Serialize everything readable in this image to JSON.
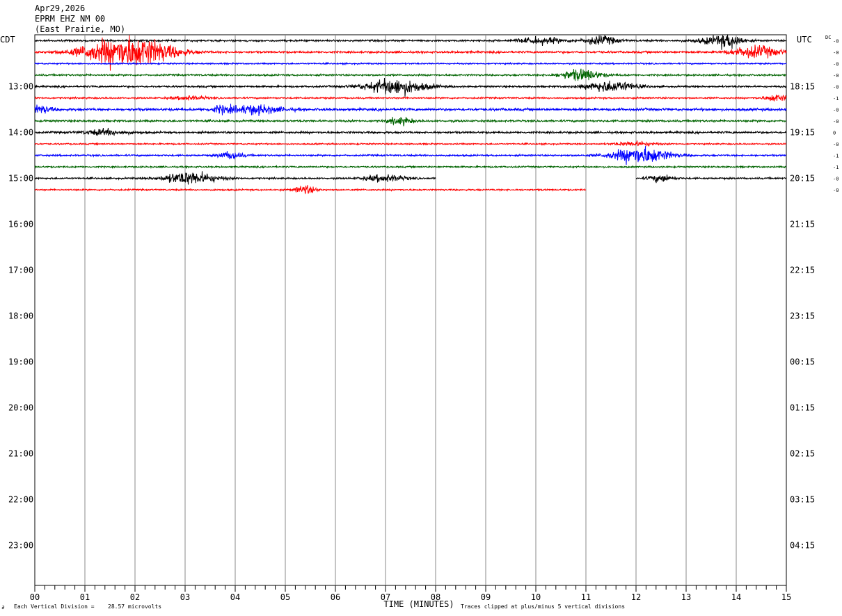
{
  "header": {
    "date": "Apr29,2026",
    "station": "EPRM EHZ NM 00",
    "location": "(East Prairie, MO)"
  },
  "left_timezone": "CDT",
  "right_timezone": "UTC",
  "dc_label": "DC",
  "footer": {
    "division_label": "Each Vertical Division =",
    "division_value": "28.57 microvolts",
    "clip_note": "Traces clipped at plus/minus 5 vertical divisions",
    "corner_mark": "∂"
  },
  "colors": [
    "#000000",
    "#ff0000",
    "#0000ff",
    "#006400"
  ],
  "chart_data": {
    "type": "line",
    "title": "EPRM EHZ NM 00",
    "xlabel": "TIME (MINUTES)",
    "xlim": [
      0,
      15
    ],
    "x_tick_labels": [
      "00",
      "01",
      "02",
      "03",
      "04",
      "05",
      "06",
      "07",
      "08",
      "09",
      "10",
      "11",
      "12",
      "13",
      "14",
      "15"
    ],
    "left_hour_labels": [
      "13:00",
      "14:00",
      "15:00",
      "16:00",
      "17:00",
      "18:00",
      "19:00",
      "20:00",
      "21:00",
      "22:00",
      "23:00"
    ],
    "right_hour_labels": [
      "18:15",
      "19:15",
      "20:15",
      "21:15",
      "22:15",
      "23:15",
      "00:15",
      "01:15",
      "02:15",
      "03:15",
      "04:15"
    ],
    "dc_offsets": [
      "-0",
      "-0",
      "-0",
      "-0",
      "-0",
      "-1",
      "-0",
      "-0",
      "0",
      "-0",
      "-1",
      "-1",
      "-0",
      "-0"
    ],
    "traces": [
      {
        "row": 0,
        "color": "black",
        "start_min": 0,
        "end_min": 15,
        "noise": 1.3,
        "events": [
          [
            10.1,
            1.2,
            4
          ],
          [
            11.3,
            0.8,
            6
          ],
          [
            13.6,
            1.0,
            5
          ],
          [
            13.9,
            0.6,
            7
          ]
        ]
      },
      {
        "row": 1,
        "color": "red",
        "start_min": 0,
        "end_min": 15,
        "noise": 1.4,
        "events": [
          [
            1.7,
            2.0,
            18
          ],
          [
            2.3,
            1.6,
            8
          ],
          [
            14.4,
            1.2,
            8
          ]
        ]
      },
      {
        "row": 2,
        "color": "blue",
        "start_min": 0,
        "end_min": 15,
        "noise": 1.0,
        "events": []
      },
      {
        "row": 3,
        "color": "green",
        "start_min": 0,
        "end_min": 15,
        "noise": 1.2,
        "events": [
          [
            10.9,
            1.0,
            8
          ]
        ]
      },
      {
        "row": 4,
        "color": "black",
        "start_min": 0,
        "end_min": 15,
        "noise": 1.3,
        "events": [
          [
            7.2,
            1.5,
            11
          ],
          [
            11.5,
            1.2,
            8
          ]
        ]
      },
      {
        "row": 5,
        "color": "red",
        "start_min": 0,
        "end_min": 15,
        "noise": 1.1,
        "events": [
          [
            3.1,
            0.8,
            3
          ],
          [
            14.8,
            0.6,
            5
          ]
        ]
      },
      {
        "row": 6,
        "color": "blue",
        "start_min": 0,
        "end_min": 15,
        "noise": 1.8,
        "events": [
          [
            0.1,
            0.6,
            5
          ],
          [
            3.7,
            0.5,
            4
          ],
          [
            4.4,
            1.3,
            6
          ]
        ]
      },
      {
        "row": 7,
        "color": "green",
        "start_min": 0,
        "end_min": 15,
        "noise": 1.4,
        "events": [
          [
            7.3,
            0.6,
            5
          ]
        ]
      },
      {
        "row": 8,
        "color": "black",
        "start_min": 0,
        "end_min": 15,
        "noise": 1.5,
        "events": [
          [
            1.4,
            1.0,
            4
          ]
        ]
      },
      {
        "row": 9,
        "color": "red",
        "start_min": 0,
        "end_min": 15,
        "noise": 1.0,
        "events": [
          [
            12.0,
            1.0,
            3
          ]
        ]
      },
      {
        "row": 10,
        "color": "blue",
        "start_min": 0,
        "end_min": 15,
        "noise": 1.2,
        "events": [
          [
            3.9,
            0.6,
            5
          ],
          [
            12.1,
            1.4,
            12
          ]
        ]
      },
      {
        "row": 11,
        "color": "green",
        "start_min": 0,
        "end_min": 15,
        "noise": 1.1,
        "events": []
      },
      {
        "row": 12,
        "color": "black",
        "start_min": 0,
        "end_min": 8.0,
        "noise": 1.2,
        "events": [
          [
            3.1,
            1.3,
            9
          ],
          [
            7.0,
            1.0,
            5
          ]
        ]
      },
      {
        "row": 12,
        "color": "black",
        "start_min": 12.0,
        "end_min": 15,
        "noise": 1.2,
        "events": [
          [
            12.5,
            0.6,
            5
          ]
        ]
      },
      {
        "row": 13,
        "color": "red",
        "start_min": 0,
        "end_min": 11.0,
        "noise": 1.1,
        "events": [
          [
            5.4,
            0.5,
            6
          ]
        ]
      }
    ]
  }
}
